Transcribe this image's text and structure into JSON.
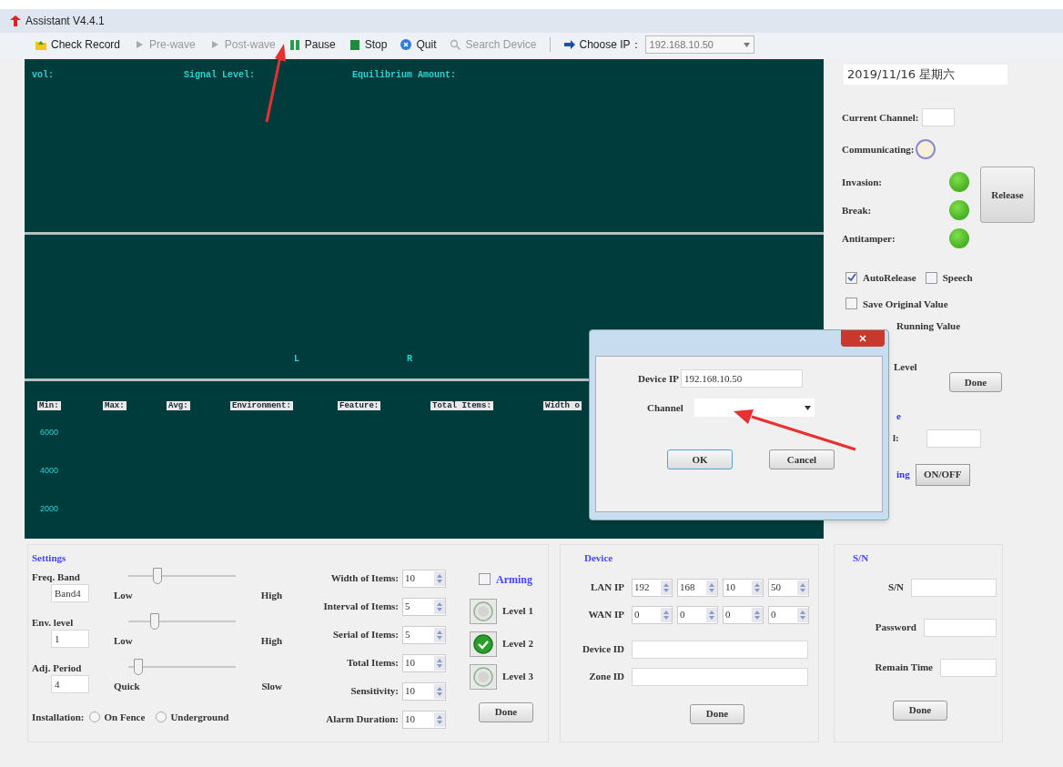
{
  "window": {
    "title": "Assistant V4.4.1"
  },
  "toolbar": [
    {
      "label": "Check Record",
      "kind": "record",
      "disabled": false
    },
    {
      "label": "Pre-wave",
      "kind": "play",
      "disabled": true
    },
    {
      "label": "Post-wave",
      "kind": "play",
      "disabled": true
    },
    {
      "label": "Pause",
      "kind": "pause",
      "disabled": false
    },
    {
      "label": "Stop",
      "kind": "stop",
      "disabled": false
    },
    {
      "label": "Quit",
      "kind": "quit",
      "disabled": false
    },
    {
      "label": "Search Device",
      "kind": "search",
      "disabled": true
    },
    {
      "label": "Choose IP：",
      "kind": "arrow",
      "disabled": false
    }
  ],
  "ip_select": {
    "value": "192.168.10.50"
  },
  "wave_panel": {
    "labels": [
      "vol:",
      "Signal Level:",
      "Equilibrium Amount:"
    ]
  },
  "channel_panel": {
    "labels": [
      "L",
      "R"
    ]
  },
  "stats_panel": {
    "labels": [
      "Min:",
      "Max:",
      "Avg:",
      "Environment:",
      "Feature:",
      "Total Items:",
      "Width o"
    ],
    "y_axis": [
      "6000",
      "4000",
      "2000"
    ]
  },
  "status": {
    "date": "2019/11/16 星期六",
    "current_channel": "Current Channel:",
    "communicating": {
      "label": "Communicating:",
      "on": false
    },
    "alarms": [
      {
        "label": "Invasion:",
        "on": true
      },
      {
        "label": "Break:",
        "on": true
      },
      {
        "label": "Antitamper:",
        "on": true
      }
    ],
    "release_button": "Release",
    "options": [
      {
        "label": "AutoRelease",
        "checked": true
      },
      {
        "label": "Speech",
        "checked": false
      },
      {
        "label": "Save Original Value",
        "checked": false
      }
    ],
    "covered_option": "Running Value",
    "level_label": "Level",
    "level_button": "Done",
    "group_fragment": "e",
    "field_fragment": "l:",
    "onoff_label": "ing",
    "onoff_button": "ON/OFF"
  },
  "settings": {
    "title": "Settings",
    "sliders": [
      {
        "label": "Freq. Band",
        "value": "Band4",
        "min_label": "Low",
        "max_label": "High",
        "level": 0.25
      },
      {
        "label": "Env. level",
        "value": "1",
        "min_label": "Low",
        "max_label": "High",
        "level": 0.22
      },
      {
        "label": "Adj. Period",
        "value": "4",
        "min_label": "Quick",
        "max_label": "Slow",
        "level": 0.06
      }
    ],
    "installation": {
      "label": "Installation:",
      "options": [
        {
          "label": "On Fence",
          "selected": false
        },
        {
          "label": "Underground",
          "selected": false
        }
      ]
    },
    "spinners": [
      {
        "label": "Width of Items:",
        "value": "10"
      },
      {
        "label": "Interval of Items:",
        "value": "5"
      },
      {
        "label": "Serial of Items:",
        "value": "5"
      },
      {
        "label": "Total Items:",
        "value": "10"
      },
      {
        "label": "Sensitivity:",
        "value": "10"
      },
      {
        "label": "Alarm Duration:",
        "value": "10"
      }
    ],
    "arming": {
      "label": "Arming",
      "checked": false
    },
    "levels": [
      {
        "label": "Level 1",
        "selected": false
      },
      {
        "label": "Level 2",
        "selected": true
      },
      {
        "label": "Level 3",
        "selected": false
      }
    ],
    "done": "Done"
  },
  "device": {
    "title": "Device",
    "ips": [
      {
        "label": "LAN IP",
        "octets": [
          "192",
          "168",
          "10",
          "50"
        ]
      },
      {
        "label": "WAN IP",
        "octets": [
          "0",
          "0",
          "0",
          "0"
        ]
      }
    ],
    "fields": [
      "Device ID",
      "Zone ID"
    ],
    "done": "Done"
  },
  "sn": {
    "title": "S/N",
    "fields": [
      "S/N",
      "Password",
      "Remain Time"
    ],
    "done": "Done"
  },
  "dialog": {
    "device_ip_label": "Device IP",
    "device_ip": "192.168.10.50",
    "channel_label": "Channel",
    "buttons": [
      "OK",
      "Cancel"
    ]
  }
}
